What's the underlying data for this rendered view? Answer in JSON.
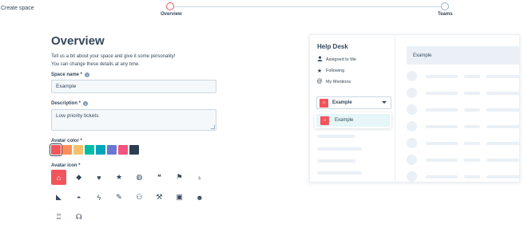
{
  "header": {
    "create_space": "Create space",
    "steps": [
      {
        "label": "Overview",
        "state": "active"
      },
      {
        "label": "Teams",
        "state": "inactive"
      }
    ]
  },
  "form": {
    "title": "Overview",
    "intro_line1": "Tell us a bit about your space and give it some personality!",
    "intro_line2": "You can change these details at any time.",
    "space_name": {
      "label": "Space name *",
      "info_icon": "i",
      "value": "Example"
    },
    "description": {
      "label": "Description *",
      "info_icon": "i",
      "value": "Low priority tickets"
    },
    "avatar_color": {
      "label": "Avatar color *",
      "colors": [
        "#f2545b",
        "#ff8f59",
        "#f5c26b",
        "#00bda5",
        "#00a4bd",
        "#6a78d1",
        "#f2547d",
        "#2d3e50"
      ],
      "selected": 0
    },
    "avatar_icon": {
      "label": "Avatar icon *",
      "icons": [
        {
          "name": "home-icon",
          "glyph": "⌂"
        },
        {
          "name": "tag-icon",
          "glyph": "◆"
        },
        {
          "name": "heart-icon",
          "glyph": "♥"
        },
        {
          "name": "star-icon",
          "glyph": "★"
        },
        {
          "name": "globe-icon",
          "glyph": "◍"
        },
        {
          "name": "chat-icon",
          "glyph": "❝"
        },
        {
          "name": "flag-icon",
          "glyph": "⚑"
        },
        {
          "name": "lightbulb-icon",
          "glyph": "♁"
        },
        {
          "name": "megaphone-icon",
          "glyph": "◣"
        },
        {
          "name": "inbox-icon",
          "glyph": "◓"
        },
        {
          "name": "lightning-icon",
          "glyph": "ϟ"
        },
        {
          "name": "pencil-icon",
          "glyph": "✎"
        },
        {
          "name": "users-icon",
          "glyph": "⚇"
        },
        {
          "name": "wrench-icon",
          "glyph": "⚒"
        },
        {
          "name": "briefcase-icon",
          "glyph": "▣"
        },
        {
          "name": "smiley-icon",
          "glyph": "☻"
        },
        {
          "name": "trophy-icon",
          "glyph": "♖"
        },
        {
          "name": "headset-icon",
          "glyph": "☊"
        }
      ],
      "selected": 0
    }
  },
  "preview": {
    "title": "Help Desk",
    "nav": [
      {
        "icon": "person-icon",
        "glyph": "👤",
        "label": "Assigned to Me"
      },
      {
        "icon": "star-icon",
        "glyph": "★",
        "label": "Following"
      },
      {
        "icon": "at-icon",
        "glyph": "@",
        "label": "My Mentions"
      }
    ],
    "dropdown_value": "Example",
    "menu_item": "Example",
    "list_header": "Example",
    "colors": {
      "accent": "#f2545b",
      "highlight": "#e5f5f8",
      "skeleton": "#eaf0f6"
    }
  }
}
